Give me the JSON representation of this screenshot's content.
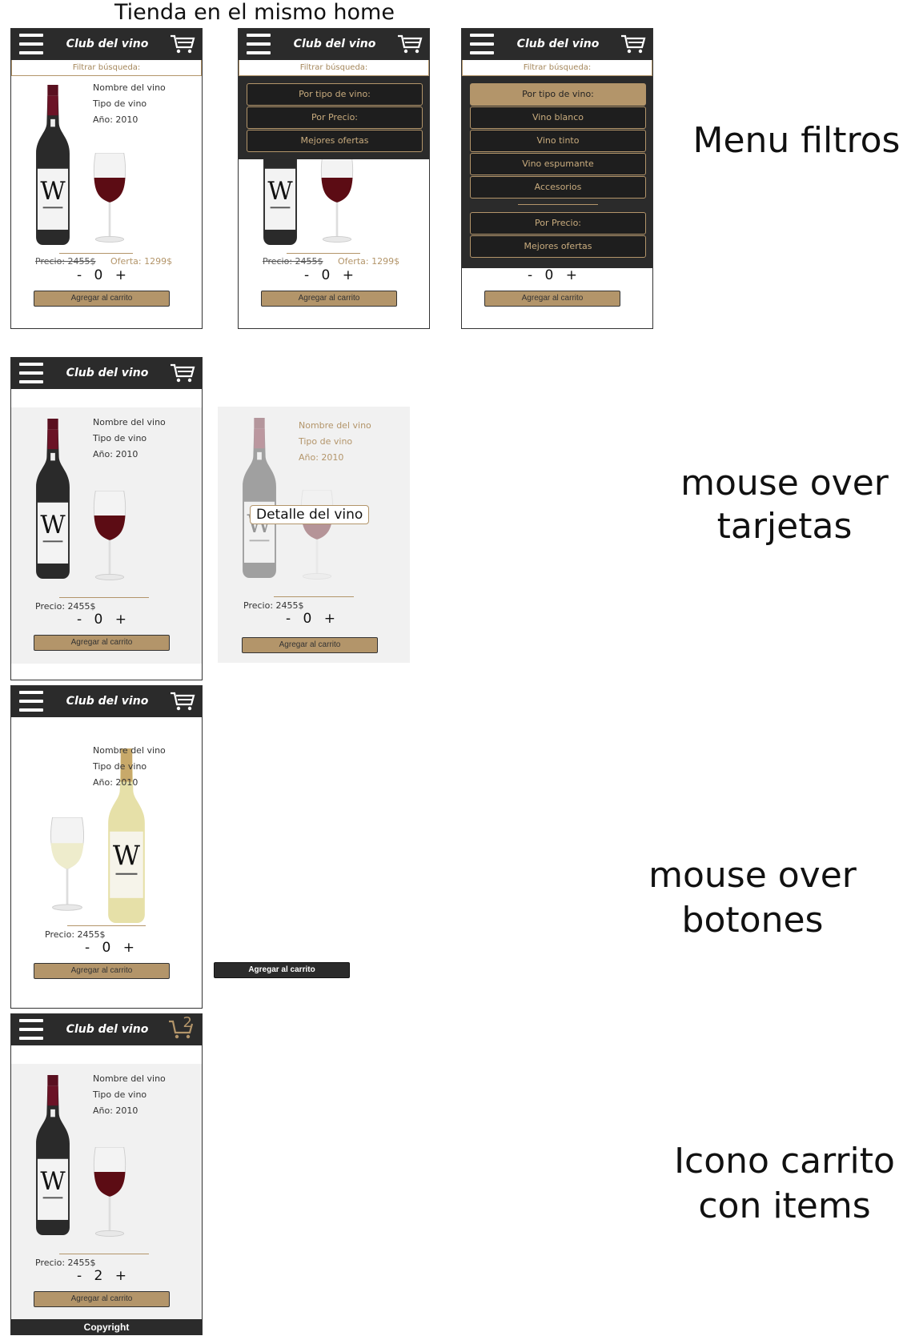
{
  "headings": {
    "home": "Tienda en el mismo home",
    "filters": "Menu filtros",
    "hover_cards_1": "mouse over",
    "hover_cards_2": "tarjetas",
    "hover_buttons_1": "mouse over",
    "hover_buttons_2": "botones",
    "cart_items_1": "Icono carrito",
    "cart_items_2": "con items"
  },
  "app": {
    "brand": "Club del vino",
    "filter_label": "Filtrar búsqueda:",
    "copyright": "Copyright"
  },
  "product": {
    "name": "Nombre del vino",
    "type": "Tipo de vino",
    "year": "Año: 2010",
    "price": "Precio: 2455$",
    "old_price": "Precio: 2455$",
    "offer": "Oferta: 1299$",
    "qty_minus": "-",
    "qty_plus": "+",
    "qty_zero": "0",
    "qty_two": "2",
    "add_to_cart": "Agregar al carrito",
    "detail_tooltip": "Detalle del vino",
    "cart_count": "2"
  },
  "filter_menu": {
    "by_type": "Por tipo de vino:",
    "by_price": "Por Precio:",
    "best_offers": "Mejores ofertas",
    "types": [
      "Vino blanco",
      "Vino tinto",
      "Vino espumante",
      "Accesorios"
    ]
  },
  "colors": {
    "accent": "#b3956a",
    "dark": "#2b2b2b",
    "card_hover": "#f1f1f1"
  }
}
